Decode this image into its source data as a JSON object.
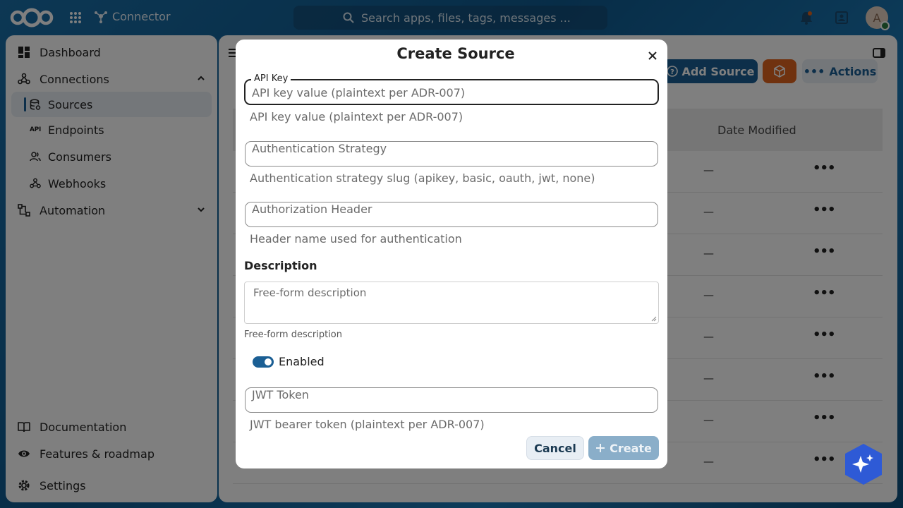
{
  "header": {
    "app_name": "Connector",
    "search_placeholder": "Search apps, files, tags, messages ...",
    "avatar_initial": "A"
  },
  "sidebar": {
    "items": [
      {
        "label": "Dashboard"
      },
      {
        "label": "Connections"
      },
      {
        "label": "Sources"
      },
      {
        "label": "Endpoints"
      },
      {
        "label": "Consumers"
      },
      {
        "label": "Webhooks"
      },
      {
        "label": "Automation"
      }
    ],
    "api_icon_text": "API",
    "footer": [
      {
        "label": "Documentation"
      },
      {
        "label": "Features & roadmap"
      },
      {
        "label": "Settings"
      }
    ]
  },
  "main": {
    "add_source_label": "Add Source",
    "actions_label": "Actions",
    "date_modified_header": "Date Modified",
    "row_placeholder": "—"
  },
  "modal": {
    "title": "Create Source",
    "api_key": {
      "label": "API Key",
      "placeholder": "API key value (plaintext per ADR-007)",
      "helper": "API key value (plaintext per ADR-007)"
    },
    "auth_strategy": {
      "placeholder": "Authentication Strategy",
      "helper": "Authentication strategy slug (apikey, basic, oauth, jwt, none)"
    },
    "auth_header": {
      "placeholder": "Authorization Header",
      "helper": "Header name used for authentication"
    },
    "description": {
      "label": "Description",
      "placeholder": "Free-form description",
      "helper": "Free-form description"
    },
    "enabled": {
      "label": "Enabled",
      "value": true
    },
    "jwt_token": {
      "placeholder": "JWT Token",
      "helper": "JWT bearer token (plaintext per ADR-007)"
    },
    "cancel_label": "Cancel",
    "create_label": "Create"
  },
  "colors": {
    "primary": "#1b5f94",
    "accent_orange": "#e0651e",
    "create_disabled": "#8aaec9"
  }
}
